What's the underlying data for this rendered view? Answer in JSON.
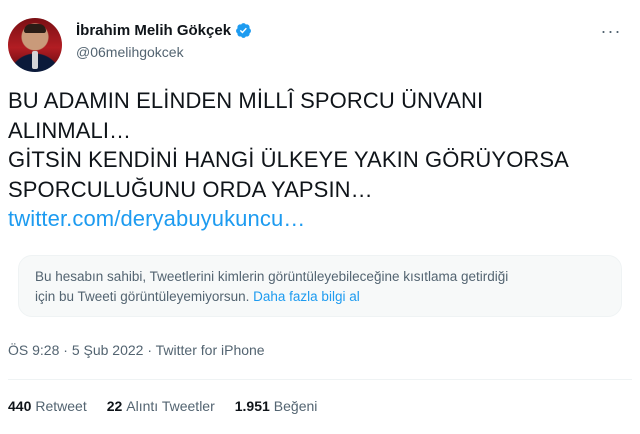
{
  "author": {
    "display_name": "İbrahim Melih Gökçek",
    "handle": "@06melihgokcek",
    "verified": true
  },
  "more_button": "···",
  "tweet": {
    "lines": [
      "BU ADAMIN ELİNDEN MİLLÎ SPORCU ÜNVANI",
      "ALINMALI…",
      "GİTSİN KENDİNİ HANGİ ÜLKEYE YAKIN GÖRÜYORSA",
      "SPORCULUĞUNU ORDA YAPSIN…"
    ],
    "link": "twitter.com/deryabuyukuncu…"
  },
  "restricted_notice": {
    "line1": "Bu hesabın sahibi, Tweetlerini kimlerin görüntüleyebileceğine kısıtlama getirdiği",
    "line2": "için bu Tweeti görüntüleyemiyorsun.",
    "link": "Daha fazla bilgi al"
  },
  "meta": {
    "time": "ÖS 9:28",
    "separator": " · ",
    "date": "5 Şub 2022",
    "source": "Twitter for iPhone"
  },
  "stats": {
    "retweets_count": "440",
    "retweets_label": "Retweet",
    "quotes_count": "22",
    "quotes_label": "Alıntı Tweetler",
    "likes_count": "1.951",
    "likes_label": "Beğeni"
  },
  "colors": {
    "accent": "#1d9bf0",
    "text": "#0f1419",
    "secondary": "#536471"
  }
}
